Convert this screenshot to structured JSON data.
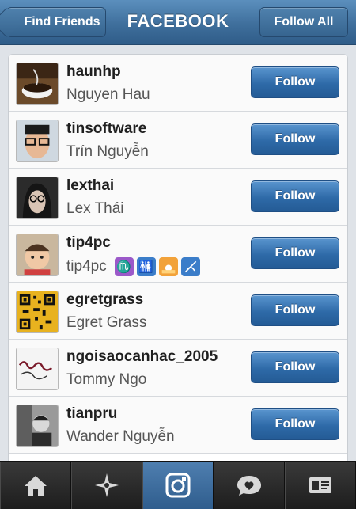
{
  "nav": {
    "back_label": "Find Friends",
    "title": "FACEBOOK",
    "follow_all_label": "Follow All"
  },
  "users": [
    {
      "username": "haunhp",
      "name": "Nguyen Hau",
      "button": "Follow",
      "avatar": "coffee-cup"
    },
    {
      "username": "tinsoftware",
      "name": "Trín Nguyễn",
      "button": "Follow",
      "avatar": "man-with-glasses"
    },
    {
      "username": "lexthai",
      "name": "Lex Thái",
      "button": "Follow",
      "avatar": "woman-with-glasses"
    },
    {
      "username": "tip4pc",
      "name": "tip4pc",
      "button": "Follow",
      "avatar": "baby",
      "emojis": [
        "scorpio-sign",
        "restroom",
        "sunset",
        "no-signal"
      ]
    },
    {
      "username": "egretgrass",
      "name": "Egret Grass",
      "button": "Follow",
      "avatar": "qr-code"
    },
    {
      "username": "ngoisaocanhac_2005",
      "name": "Tommy Ngo",
      "button": "Follow",
      "avatar": "handwriting"
    },
    {
      "username": "tianpru",
      "name": "Wander Nguyễn",
      "button": "Follow",
      "avatar": "man-in-black-and-white"
    }
  ],
  "tabs": [
    {
      "name": "home-icon",
      "active": false
    },
    {
      "name": "explore-icon",
      "active": false
    },
    {
      "name": "camera-icon",
      "active": true
    },
    {
      "name": "news-icon",
      "active": false
    },
    {
      "name": "profile-icon",
      "active": false
    }
  ],
  "colors": {
    "accent": "#3f6f9c",
    "button": "#2e6aa8"
  }
}
